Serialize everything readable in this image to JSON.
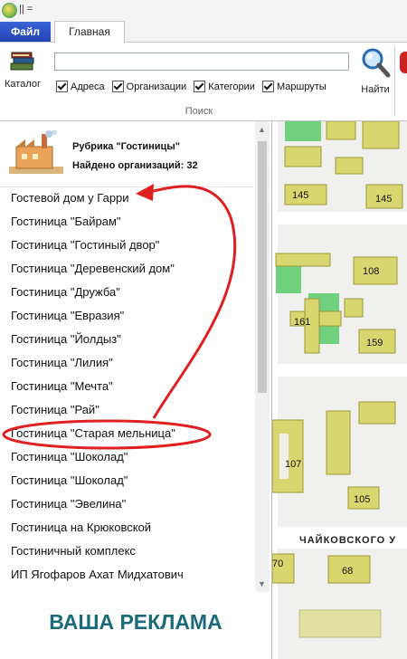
{
  "titlebar": {
    "qat_glyph": "|| ="
  },
  "tabs": {
    "file": "Файл",
    "home": "Главная"
  },
  "ribbon": {
    "catalog_label": "Каталог",
    "search_value": "",
    "filters": [
      "Адреса",
      "Организации",
      "Категории",
      "Маршруты"
    ],
    "find_label": "Найти",
    "group_label": "Поиск"
  },
  "results": {
    "rubric": "Рубрика \"Гостиницы\"",
    "found": "Найдено организаций: 32",
    "items": [
      "Гостевой дом у Гарри",
      "Гостиница \"Байрам\"",
      "Гостиница \"Гостиный двор\"",
      "Гостиница \"Деревенский дом\"",
      "Гостиница \"Дружба\"",
      "Гостиница \"Евразия\"",
      "Гостиница \"Йолдыз\"",
      "Гостиница \"Лилия\"",
      "Гостиница \"Мечта\"",
      "Гостиница \"Рай\"",
      "Гостиница \"Старая мельница\"",
      "Гостиница \"Шоколад\"",
      "Гостиница \"Шоколад\"",
      "Гостиница \"Эвелина\"",
      "Гостиница на Крюковской",
      "Гостиничный комплекс",
      "ИП Ягофаров Ахат Мидхатович"
    ],
    "highlighted_item": "Гостиница \"Старая мельница\""
  },
  "ad_text": "ВАША РЕКЛАМА",
  "map": {
    "building_numbers": [
      "145",
      "145",
      "108",
      "161",
      "159",
      "107",
      "105",
      "70",
      "68"
    ],
    "street": "ЧАЙКОВСКОГО У"
  },
  "colors": {
    "building": "#d8d66e",
    "park": "#6fd07e",
    "highlight": "#e02020",
    "ad": "#1a6a7a"
  },
  "icons": [
    "app-icon",
    "catalog-books-icon",
    "magnifier-icon",
    "factory-icon",
    "arrow-annotation-icon"
  ]
}
